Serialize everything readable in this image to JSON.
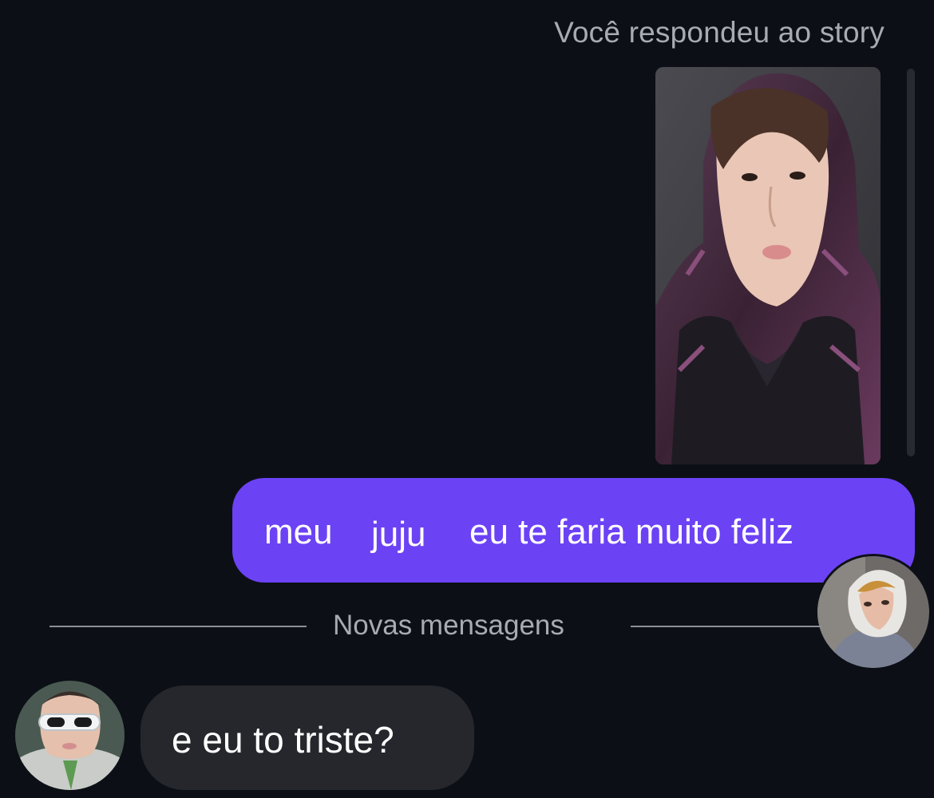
{
  "story_reply": {
    "caption": "Você respondeu ao story"
  },
  "sent_message": {
    "word_1": "meu",
    "word_2": "juju",
    "word_3": "eu te faria muito feliz"
  },
  "divider": {
    "label": "Novas mensagens"
  },
  "received_message": {
    "text": "e eu to triste?"
  },
  "colors": {
    "background": "#0c1016",
    "sent_bubble": "#6c42f5",
    "received_bubble": "#25272c",
    "muted_text": "#a8abb2"
  }
}
